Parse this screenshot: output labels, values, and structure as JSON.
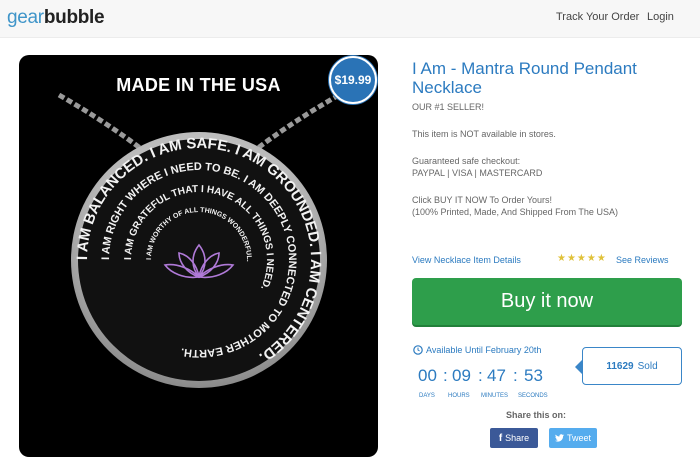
{
  "header": {
    "logo_part1": "gear",
    "logo_part2": "bubble",
    "nav": {
      "track": "Track Your Order",
      "login": "Login"
    }
  },
  "product": {
    "image_caption": "MADE IN THE USA",
    "price": "$19.99",
    "title": "I Am - Mantra Round Pendant Necklace",
    "seller": "OUR #1 SELLER!",
    "stores": "This item is NOT available in stores.",
    "checkout_label": "Guaranteed safe checkout:",
    "payments": "PAYPAL | VISA | MASTERCARD",
    "cta_text": "Click BUY IT NOW To Order Yours!",
    "made_text": "(100% Printed, Made, And Shipped From The USA)",
    "details_link": "View Necklace Item Details",
    "stars": "★★★★★",
    "reviews_link": "See Reviews",
    "buy_button": "Buy it now"
  },
  "availability": {
    "text": "Available Until February 20th",
    "countdown": {
      "days": "00",
      "hours": "09",
      "minutes": "47",
      "seconds": "53",
      "days_label": "DAYS",
      "hours_label": "HOURS",
      "minutes_label": "MINUTES",
      "seconds_label": "SECONDS"
    },
    "sold_count": "11629",
    "sold_label": "Sold"
  },
  "share": {
    "title": "Share this on:",
    "facebook": "Share",
    "twitter": "Tweet"
  },
  "colors": {
    "accent": "#2c7bc0",
    "buy": "#2e9e4b",
    "facebook": "#3b5998",
    "twitter": "#55acee",
    "badge": "#2a73b6"
  },
  "icons": [
    "clock-icon",
    "facebook-icon",
    "twitter-icon",
    "star-icon"
  ]
}
